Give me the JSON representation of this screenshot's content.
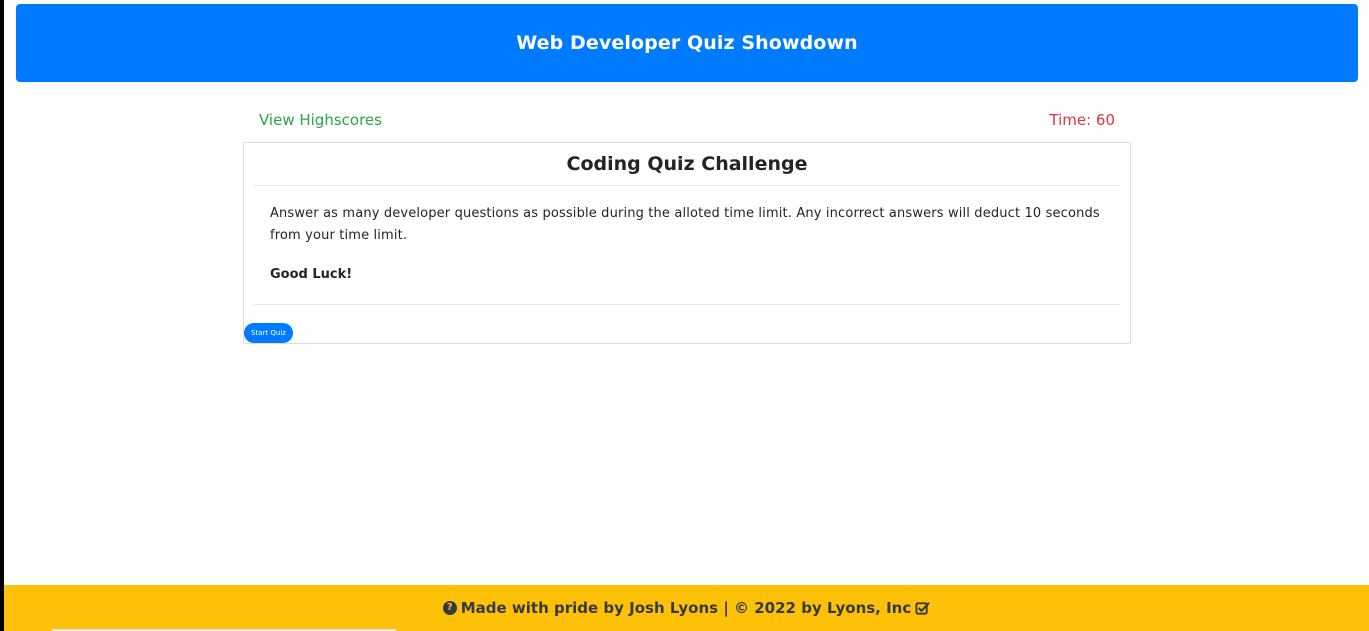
{
  "header": {
    "title": "Web Developer Quiz Showdown"
  },
  "nav": {
    "view_highscores": "View Highscores",
    "timer": "Time: 60"
  },
  "card": {
    "title": "Coding Quiz Challenge",
    "description": "Answer as many developer questions as possible during the alloted time limit. Any incorrect answers will deduct 10 seconds from your time limit.",
    "good_luck": "Good Luck!",
    "start_button": "Start Quiz"
  },
  "footer": {
    "text": "Made with pride by Josh Lyons | © 2022 by Lyons, Inc",
    "left_icon": "question-circle-icon",
    "right_icon": "check-square-icon"
  },
  "colors": {
    "header_bg": "#007bff",
    "highscores_link": "#28a745",
    "timer_text": "#dc3545",
    "footer_bg": "#ffc107",
    "button_bg": "#007bff"
  }
}
